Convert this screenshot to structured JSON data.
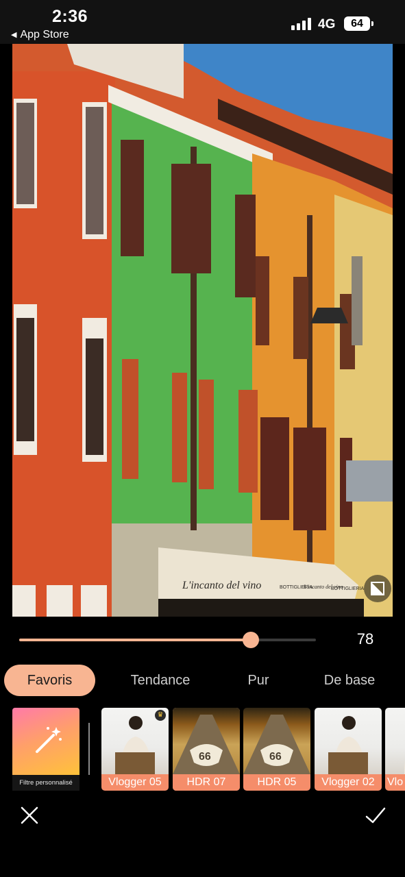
{
  "status_bar": {
    "time": "2:36",
    "back_app": "App Store",
    "network": "4G",
    "battery": "64",
    "back_icon": "back-triangle-icon",
    "signal_icon": "cellular-signal-icon"
  },
  "editor": {
    "intensity_value": "78",
    "intensity_fraction": 0.78,
    "compare_icon": "compare-split-icon",
    "accent_color": "#f8b592"
  },
  "tabs": [
    {
      "label": "Favoris",
      "active": true
    },
    {
      "label": "Tendance",
      "active": false
    },
    {
      "label": "Pur",
      "active": false
    },
    {
      "label": "De base",
      "active": false
    }
  ],
  "custom_filter": {
    "label": "Filtre personnalisé",
    "icon": "magic-wand-icon"
  },
  "filters": [
    {
      "label": "Vlogger 05",
      "thumb": "portrait",
      "premium": true,
      "selected": false
    },
    {
      "label": "HDR 07",
      "thumb": "road",
      "premium": false,
      "selected": true
    },
    {
      "label": "HDR 05",
      "thumb": "road",
      "premium": false,
      "selected": false
    },
    {
      "label": "Vlogger 02",
      "thumb": "portrait",
      "premium": false,
      "selected": false
    },
    {
      "label": "Vlo",
      "thumb": "portrait",
      "premium": false,
      "selected": false
    }
  ],
  "photo": {
    "awning_text": "L'incanto del vino",
    "awning_small_1": "BOTTIGLIERIA",
    "awning_small_2": "L'incanto del vino",
    "awning_small_3": "BOTTIGLIERIA"
  },
  "actions": {
    "cancel_icon": "close-icon",
    "confirm_icon": "checkmark-icon"
  }
}
